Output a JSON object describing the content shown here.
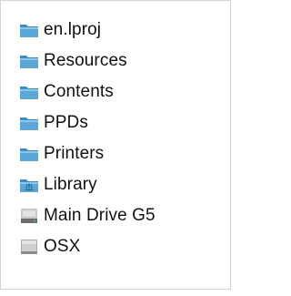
{
  "path_menu": {
    "items": [
      {
        "label": "en.lproj",
        "icon": "folder-icon"
      },
      {
        "label": "Resources",
        "icon": "folder-icon"
      },
      {
        "label": "Contents",
        "icon": "folder-icon"
      },
      {
        "label": "PPDs",
        "icon": "folder-icon"
      },
      {
        "label": "Printers",
        "icon": "folder-icon"
      },
      {
        "label": "Library",
        "icon": "library-folder-icon"
      },
      {
        "label": "Main Drive G5",
        "icon": "hard-drive-icon"
      },
      {
        "label": "OSX",
        "icon": "disk-icon"
      }
    ]
  },
  "colors": {
    "folder_body": "#5aa7d8",
    "folder_tab": "#3f8cc3",
    "drive_body": "#8f8f8f",
    "disk_body": "#b5b5b5"
  }
}
